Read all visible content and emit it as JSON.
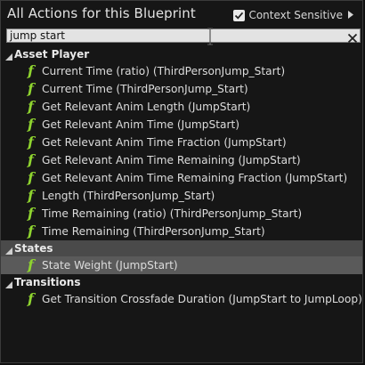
{
  "header": {
    "title": "All Actions for this Blueprint",
    "context_sensitive_label": "Context Sensitive",
    "context_sensitive_checked": true
  },
  "search": {
    "value": "jump start",
    "cursor_icon": "text-ibeam-cursor-icon",
    "clear_icon": "close-icon"
  },
  "colors": {
    "function_icon": "#8fd42f",
    "selected_row": "#5a5a5a",
    "selected_category": "#4a4a4a"
  },
  "tree": {
    "asset_player": {
      "label": "Asset Player",
      "items": [
        "Current Time (ratio) (ThirdPersonJump_Start)",
        "Current Time (ThirdPersonJump_Start)",
        "Get Relevant Anim Length (JumpStart)",
        "Get Relevant Anim Time (JumpStart)",
        "Get Relevant Anim Time Fraction (JumpStart)",
        "Get Relevant Anim Time Remaining (JumpStart)",
        "Get Relevant Anim Time Remaining Fraction (JumpStart)",
        "Length (ThirdPersonJump_Start)",
        "Time Remaining (ratio) (ThirdPersonJump_Start)",
        "Time Remaining (ThirdPersonJump_Start)"
      ]
    },
    "states": {
      "label": "States",
      "items": [
        "State Weight (JumpStart)"
      ]
    },
    "transitions": {
      "label": "Transitions",
      "items": [
        "Get Transition Crossfade Duration (JumpStart to JumpLoop)"
      ]
    },
    "function_glyph": "f"
  }
}
